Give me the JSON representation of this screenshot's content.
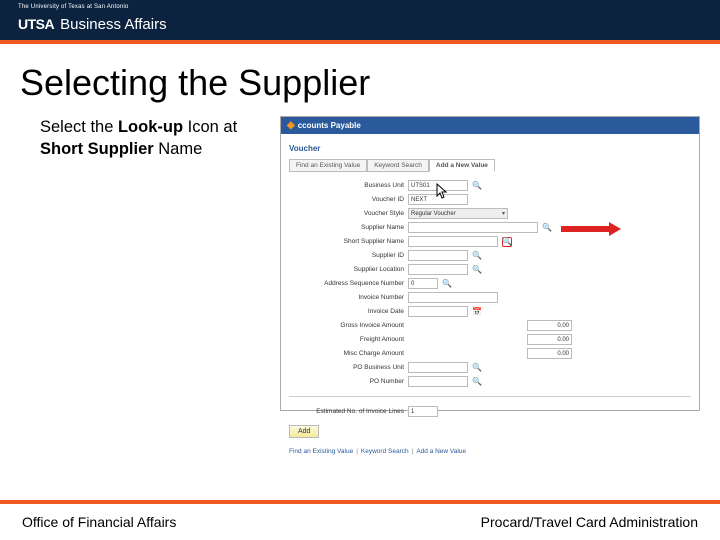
{
  "header": {
    "university_tag": "The University of Texas at San Antonio",
    "logo_bold": "UTSA",
    "logo_light": "Business Affairs"
  },
  "slide": {
    "title": "Selecting the Supplier",
    "instruction_pre": "Select the ",
    "instruction_bold1": "Look-up",
    "instruction_mid": " Icon at ",
    "instruction_bold2": "Short Supplier",
    "instruction_post": " Name"
  },
  "screenshot": {
    "appbar_label": "ccounts Payable",
    "breadcrumb": "Voucher",
    "tabs": {
      "find": "Find an Existing Value",
      "keyword": "Keyword Search",
      "add": "Add a New Value"
    },
    "fields": {
      "business_unit": {
        "label": "Business Unit",
        "value": "UTS01"
      },
      "voucher_id": {
        "label": "Voucher ID",
        "value": "NEXT"
      },
      "voucher_style": {
        "label": "Voucher Style",
        "value": "Regular Voucher"
      },
      "supplier_name": {
        "label": "Supplier Name"
      },
      "short_supplier_name": {
        "label": "Short Supplier Name"
      },
      "supplier_id": {
        "label": "Supplier ID"
      },
      "supplier_location": {
        "label": "Supplier Location"
      },
      "addr_seq": {
        "label": "Address Sequence Number",
        "value": "0"
      },
      "invoice_number": {
        "label": "Invoice Number"
      },
      "invoice_date": {
        "label": "Invoice Date"
      },
      "gross_amount": {
        "label": "Gross Invoice Amount",
        "value": "0.00"
      },
      "freight": {
        "label": "Freight Amount",
        "value": "0.00"
      },
      "misc": {
        "label": "Misc Charge Amount",
        "value": "0.00"
      },
      "po_bu": {
        "label": "PO Business Unit"
      },
      "po_number": {
        "label": "PO Number"
      },
      "est_lines": {
        "label": "Estimated No. of Invoice Lines",
        "value": "1"
      }
    },
    "add_button": "Add",
    "bottom_links": {
      "find": "Find an Existing Value",
      "keyword": "Keyword Search",
      "add": "Add a New Value"
    }
  },
  "footer": {
    "left": "Office of Financial Affairs",
    "right": "Procard/Travel Card Administration"
  }
}
